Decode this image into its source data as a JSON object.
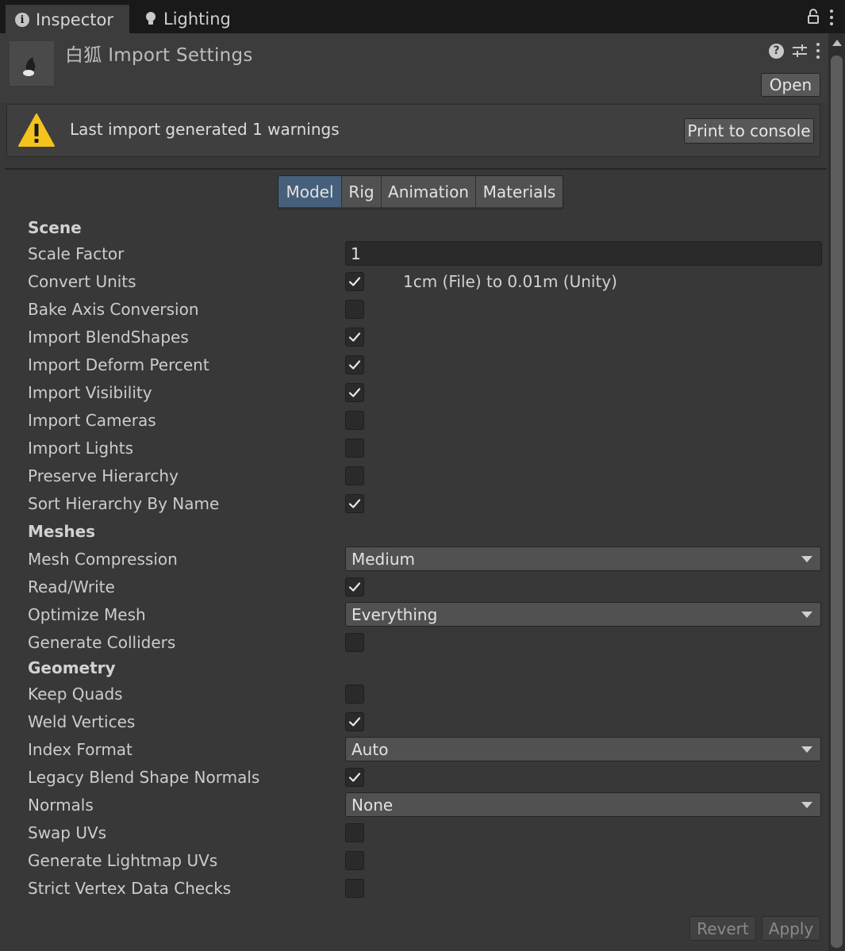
{
  "tabs": [
    {
      "label": "Inspector",
      "icon": "info-icon",
      "active": true
    },
    {
      "label": "Lighting",
      "icon": "lightbulb-icon",
      "active": false
    }
  ],
  "header": {
    "title": "白狐 Import Settings",
    "open_label": "Open"
  },
  "warning": {
    "text": "Last import generated 1 warnings",
    "button_label": "Print to console"
  },
  "subtabs": [
    "Model",
    "Rig",
    "Animation",
    "Materials"
  ],
  "selected_subtab": "Model",
  "scene": {
    "heading": "Scene",
    "scale_factor_label": "Scale Factor",
    "scale_factor_value": "1",
    "convert_units_label": "Convert Units",
    "convert_units_info": "1cm (File) to 0.01m (Unity)",
    "checkbox_rows": [
      {
        "label": "Convert Units",
        "checked": true
      },
      {
        "label": "Bake Axis Conversion",
        "checked": false
      },
      {
        "label": "Import BlendShapes",
        "checked": true
      },
      {
        "label": "Import Deform Percent",
        "checked": true
      },
      {
        "label": "Import Visibility",
        "checked": true
      },
      {
        "label": "Import Cameras",
        "checked": false
      },
      {
        "label": "Import Lights",
        "checked": false
      },
      {
        "label": "Preserve Hierarchy",
        "checked": false
      },
      {
        "label": "Sort Hierarchy By Name",
        "checked": true
      }
    ]
  },
  "meshes": {
    "heading": "Meshes",
    "mesh_compression_label": "Mesh Compression",
    "mesh_compression_value": "Medium",
    "read_write_label": "Read/Write",
    "read_write_checked": true,
    "optimize_mesh_label": "Optimize Mesh",
    "optimize_mesh_value": "Everything",
    "generate_colliders_label": "Generate Colliders",
    "generate_colliders_checked": false
  },
  "geometry": {
    "heading": "Geometry",
    "keep_quads_label": "Keep Quads",
    "keep_quads_checked": false,
    "weld_vertices_label": "Weld Vertices",
    "weld_vertices_checked": true,
    "index_format_label": "Index Format",
    "index_format_value": "Auto",
    "legacy_blend_label": "Legacy Blend Shape Normals",
    "legacy_blend_checked": true,
    "normals_label": "Normals",
    "normals_value": "None",
    "swap_uvs_label": "Swap UVs",
    "swap_uvs_checked": false,
    "lightmap_uvs_label": "Generate Lightmap UVs",
    "lightmap_uvs_checked": false,
    "strict_vertex_label": "Strict Vertex Data Checks",
    "strict_vertex_checked": false
  },
  "footer": {
    "revert_label": "Revert",
    "apply_label": "Apply"
  },
  "colors": {
    "background": "#383838",
    "selected_tab": "#46607c",
    "warning_yellow": "#f4c31c"
  }
}
